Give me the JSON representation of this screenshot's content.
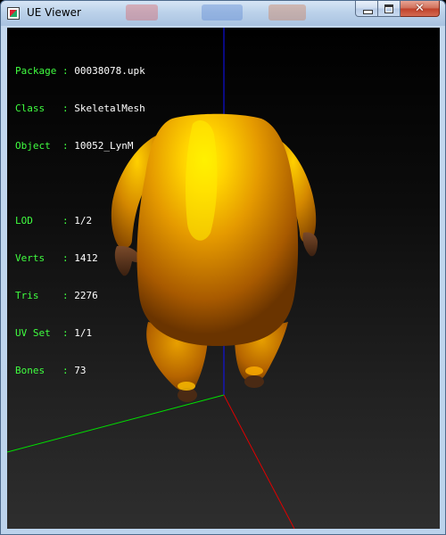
{
  "window": {
    "title": "UE Viewer",
    "icon": "app-icon",
    "controls": {
      "minimize": "minimize-icon",
      "maximize": "maximize-icon",
      "close_glyph": "✕"
    }
  },
  "viewport": {
    "background_top": "#000000",
    "background_bottom": "#2e2e2e",
    "info": {
      "package_label": "Package",
      "package_value": "00038078.upk",
      "class_label": "Class",
      "class_value": "SkeletalMesh",
      "object_label": "Object",
      "object_value": "10052_LynM",
      "lod_label": "LOD",
      "lod_value": "1/2",
      "verts_label": "Verts",
      "verts_value": "1412",
      "tris_label": "Tris",
      "tris_value": "2276",
      "uvset_label": "UV Set",
      "uvset_value": "1/1",
      "bones_label": "Bones",
      "bones_value": "73"
    },
    "axes": {
      "x_color": "#ff0000",
      "y_color": "#00ff00",
      "z_color": "#0000ff"
    },
    "mesh": {
      "color": "#e8a000",
      "highlight": "#fff200",
      "shadow": "#6a3400"
    }
  }
}
